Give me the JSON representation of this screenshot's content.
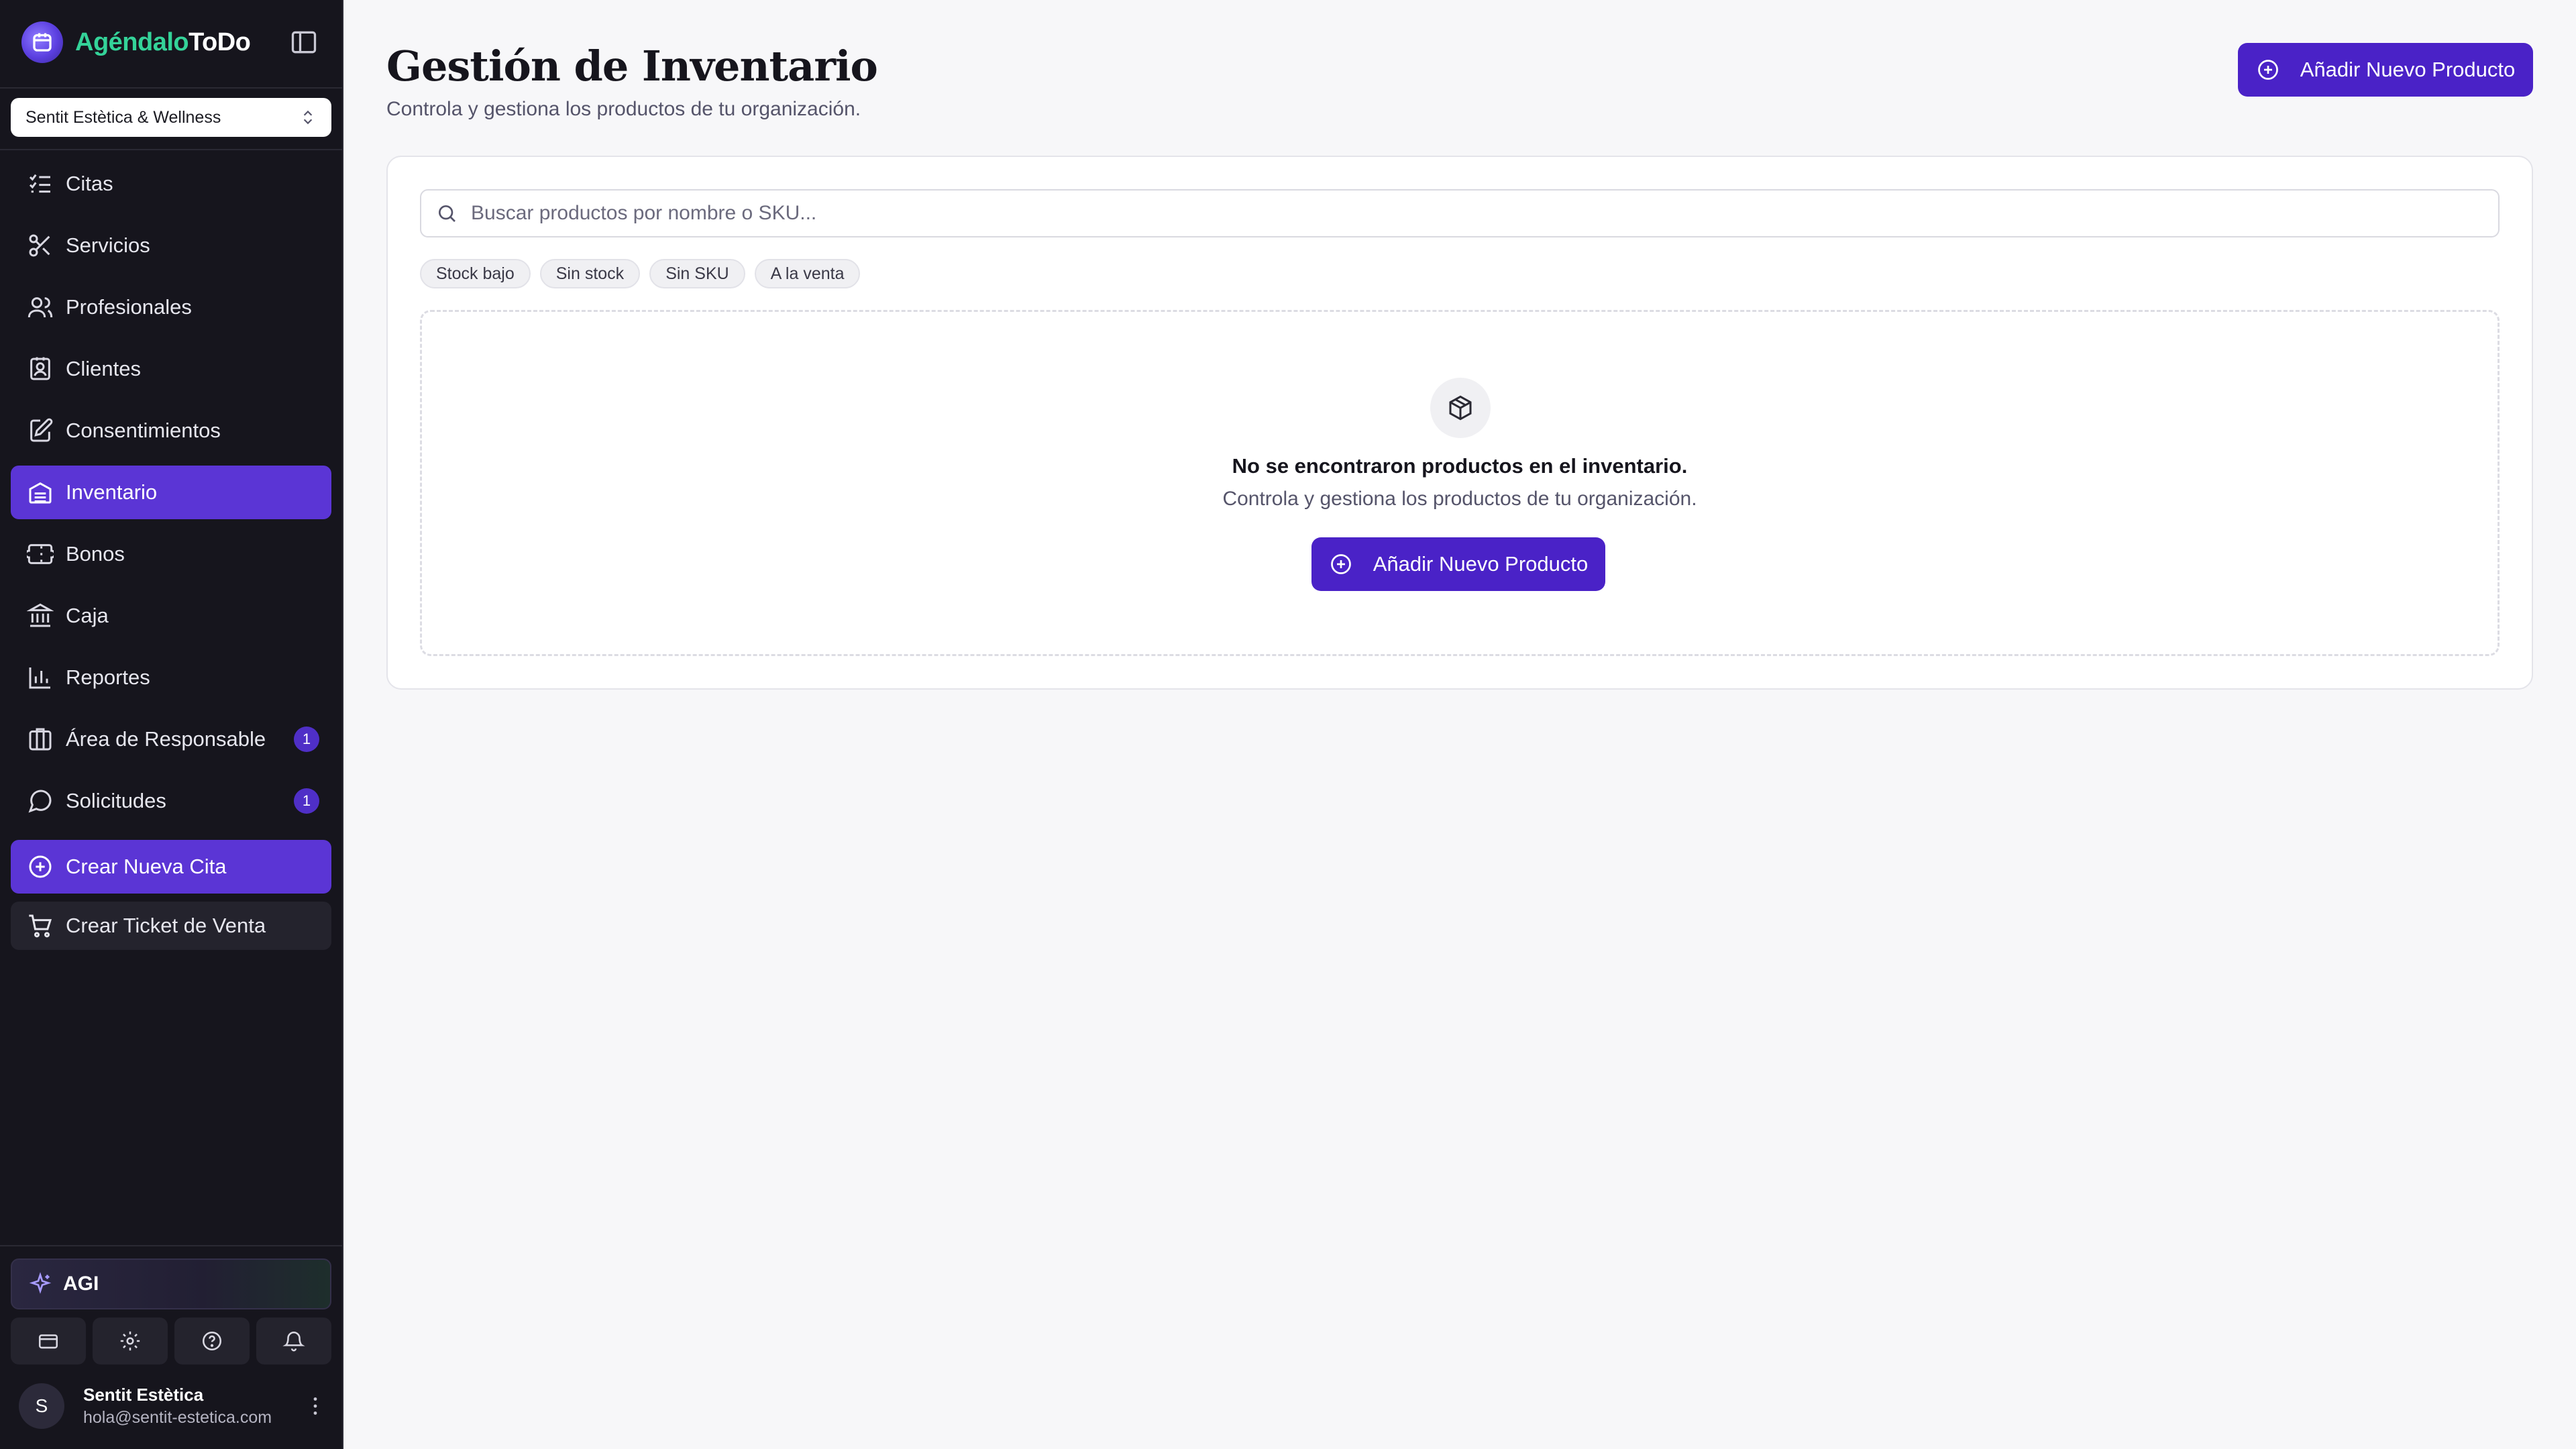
{
  "brand": {
    "name_part1": "Agéndalo",
    "name_part2": "ToDo"
  },
  "org_select": {
    "value": "Sentit Estètica & Wellness"
  },
  "sidebar": {
    "items": [
      {
        "label": "Citas",
        "icon": "list-check-icon"
      },
      {
        "label": "Servicios",
        "icon": "scissors-icon"
      },
      {
        "label": "Profesionales",
        "icon": "users-icon"
      },
      {
        "label": "Clientes",
        "icon": "contact-book-icon"
      },
      {
        "label": "Consentimientos",
        "icon": "file-pen-icon"
      },
      {
        "label": "Inventario",
        "icon": "inventory-icon",
        "active": true
      },
      {
        "label": "Bonos",
        "icon": "ticket-icon"
      },
      {
        "label": "Caja",
        "icon": "bank-icon"
      },
      {
        "label": "Reportes",
        "icon": "bar-chart-icon"
      },
      {
        "label": "Área de Responsable",
        "icon": "building-icon",
        "badge": "1"
      },
      {
        "label": "Solicitudes",
        "icon": "message-circle-icon",
        "badge": "1"
      }
    ],
    "create_appointment": "Crear Nueva Cita",
    "create_ticket": "Crear Ticket de Venta",
    "agi_label": "AGI"
  },
  "user": {
    "initial": "S",
    "name": "Sentit Estètica",
    "email": "hola@sentit-estetica.com"
  },
  "page": {
    "title": "Gestión de Inventario",
    "subtitle": "Controla y gestiona los productos de tu organización.",
    "add_button": "Añadir Nuevo Producto"
  },
  "search": {
    "placeholder": "Buscar productos por nombre o SKU..."
  },
  "filters": [
    "Stock bajo",
    "Sin stock",
    "Sin SKU",
    "A la venta"
  ],
  "empty_state": {
    "title": "No se encontraron productos en el inventario.",
    "description": "Controla y gestiona los productos de tu organización.",
    "button": "Añadir Nuevo Producto"
  },
  "colors": {
    "accent": "#4a22c7",
    "sidebar_bg": "#16151d",
    "active_item": "#5b35d5",
    "brand_green": "#34d399"
  }
}
